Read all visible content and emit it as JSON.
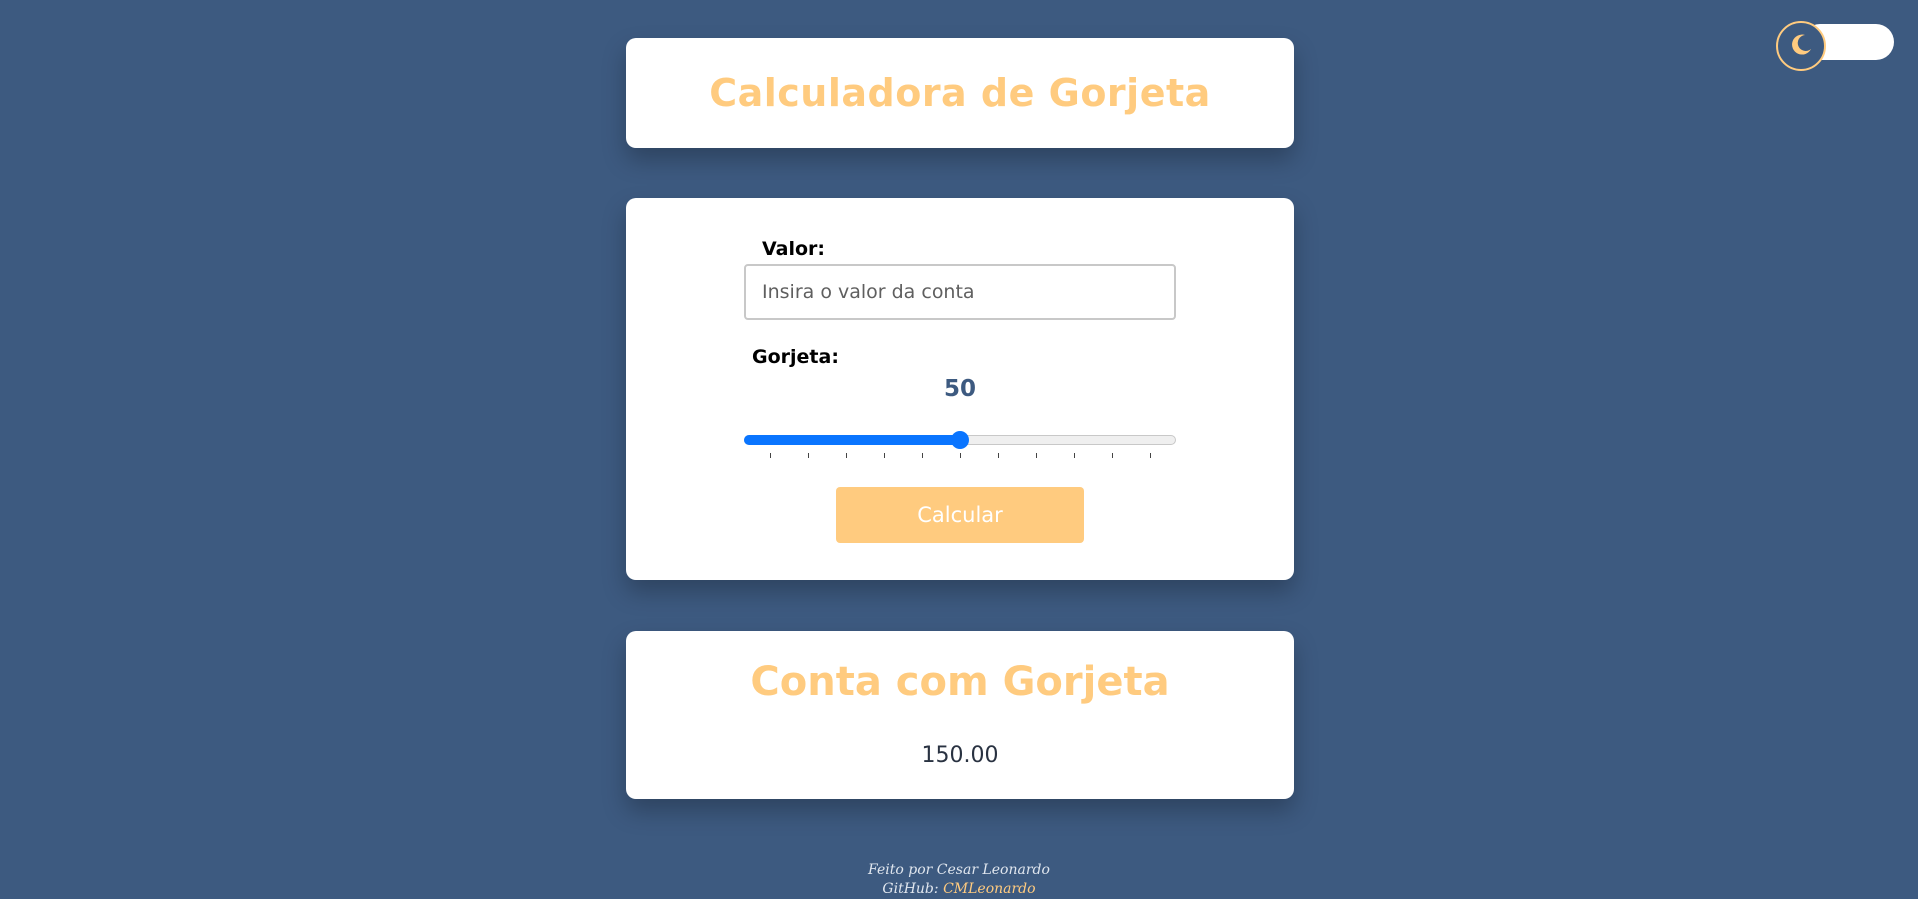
{
  "theme_toggle": {
    "icon": "moon-icon",
    "colors": {
      "knob_border": "#ffcb7f",
      "moon": "#ffcb7f"
    }
  },
  "header": {
    "title": "Calculadora de Gorjeta"
  },
  "form": {
    "valor_label": "Valor:",
    "valor_placeholder": "Insira o valor da conta",
    "valor_value": "",
    "gorjeta_label": "Gorjeta:",
    "gorjeta_value": "50",
    "slider": {
      "min": 0,
      "max": 100,
      "value": 50,
      "tick_count": 11
    },
    "button_label": "Calcular"
  },
  "result": {
    "title": "Conta com Gorjeta",
    "value": "150.00"
  },
  "footer": {
    "line1": "Feito por Cesar Leonardo",
    "github_label": "GitHub:",
    "github_link": "CMLeonardo"
  },
  "colors": {
    "background": "#3d5a80",
    "accent": "#ffcb7f",
    "slider": "#0a75ff",
    "card": "#ffffff"
  }
}
